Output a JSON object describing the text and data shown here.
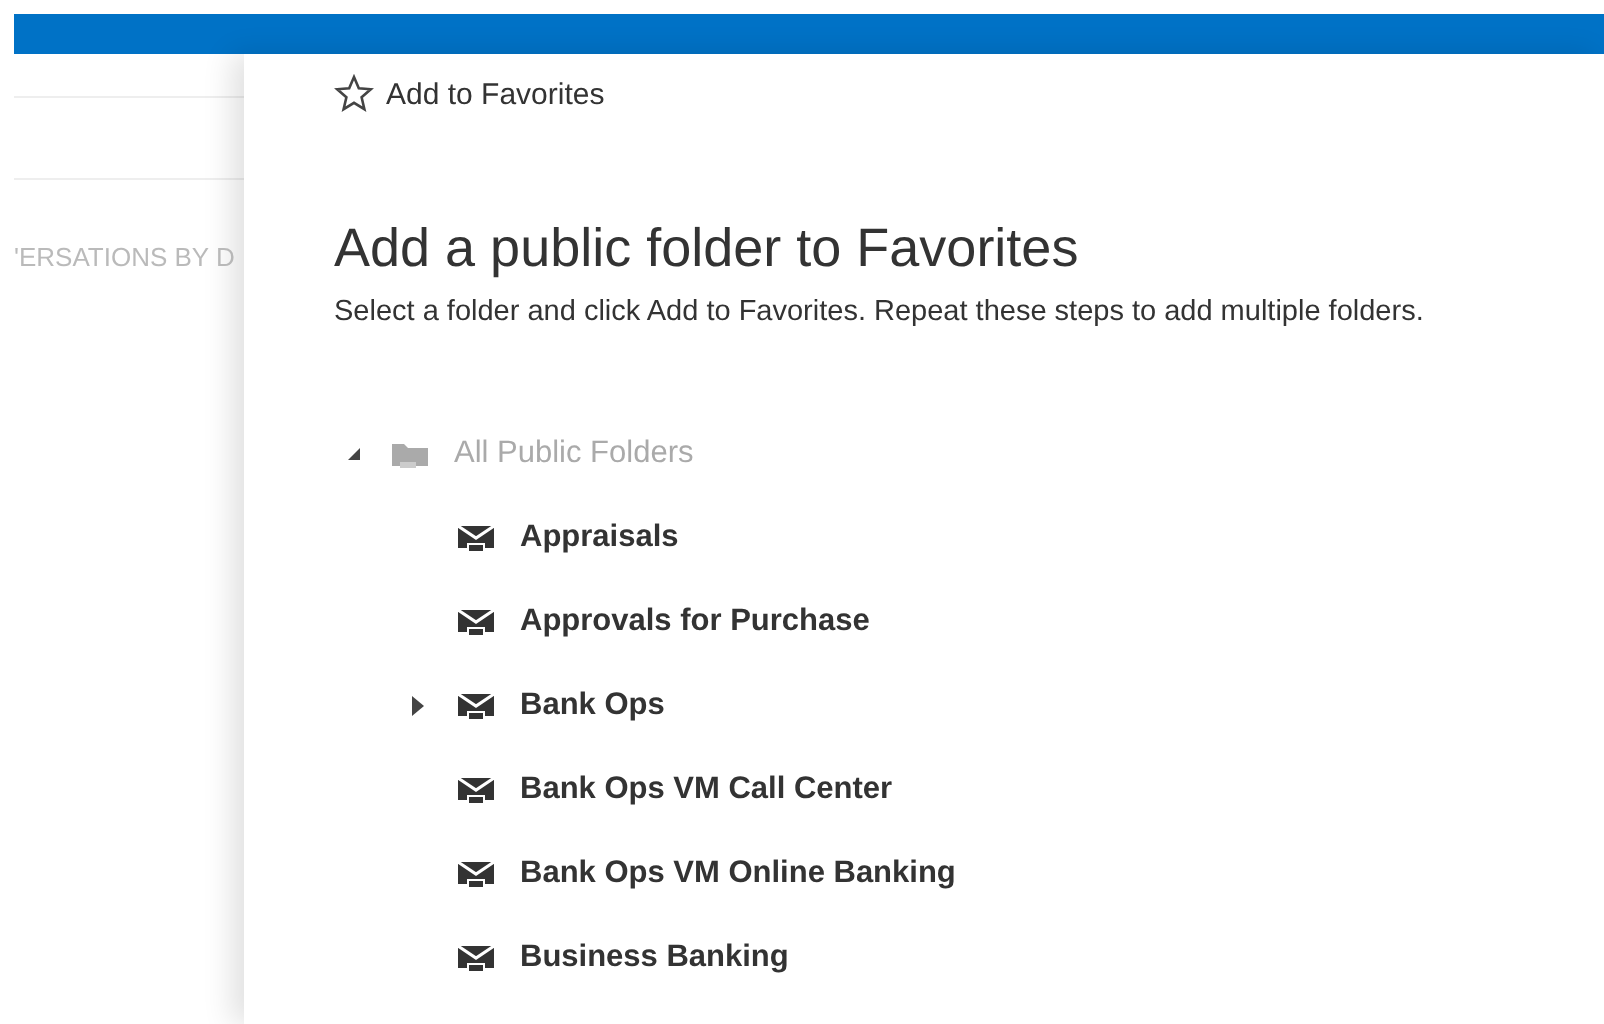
{
  "left_pane": {
    "header": "'ERSATIONS BY D"
  },
  "toolbar": {
    "add_to_favorites": "Add to Favorites"
  },
  "title": "Add a public folder to Favorites",
  "instructions": "Select a folder and click Add to Favorites. Repeat these steps to add multiple folders.",
  "tree": [
    {
      "label": "All Public Folders",
      "kind": "root",
      "expanded": true,
      "children": [
        {
          "label": "Appraisals",
          "kind": "leaf"
        },
        {
          "label": "Approvals for Purchase",
          "kind": "leaf"
        },
        {
          "label": "Bank Ops",
          "kind": "branch",
          "expanded": false
        },
        {
          "label": "Bank Ops VM Call Center",
          "kind": "leaf"
        },
        {
          "label": "Bank Ops VM Online Banking",
          "kind": "leaf"
        },
        {
          "label": "Business Banking",
          "kind": "leaf"
        }
      ]
    }
  ]
}
